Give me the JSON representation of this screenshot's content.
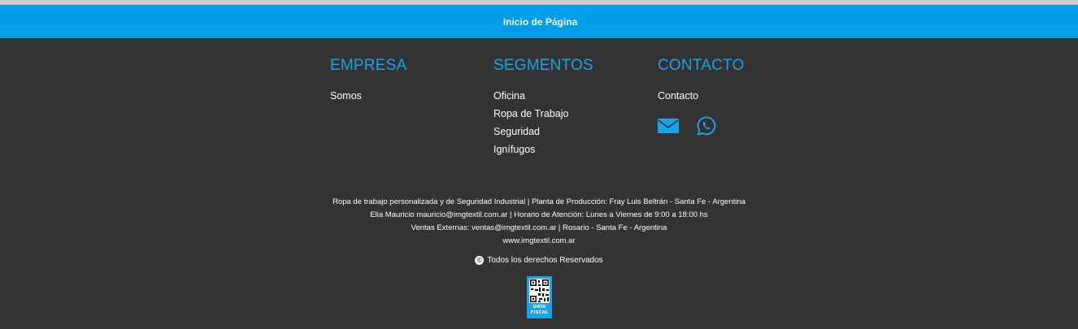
{
  "back_to_top": {
    "label": "Inicio de Página"
  },
  "columns": {
    "empresa": {
      "title": "EMPRESA",
      "items": [
        "Somos"
      ]
    },
    "segmentos": {
      "title": "SEGMENTOS",
      "items": [
        "Oficina",
        "Ropa de Trabajo",
        "Seguridad",
        "Ignífugos"
      ]
    },
    "contacto": {
      "title": "CONTACTO",
      "items": [
        "Contacto"
      ],
      "icons": [
        "envelope-icon",
        "whatsapp-icon"
      ]
    }
  },
  "info": {
    "lines": [
      "Ropa de trabajo personalizada y de Seguridad Industrial | Planta de Producción: Fray Luis Beltrán - Santa Fe - Argentina",
      "Elia Mauricio mauricio@imgtextil.com.ar | Horario de Atención: Lunes a Viernes de 9:00 a 18:00 hs",
      "Ventas Externas: ventas@imgtextil.com.ar | Rosario - Santa Fe - Argentina",
      "www.imgtextil.com.ar"
    ]
  },
  "rights": {
    "symbol": "©",
    "text": "Todos los derechos Reservados"
  },
  "fiscal": {
    "line1": "DATA",
    "line2": "FISCAL"
  },
  "colors": {
    "accent": "#009ee8",
    "footer_bg": "#333333",
    "heading": "#1aa3e8"
  }
}
